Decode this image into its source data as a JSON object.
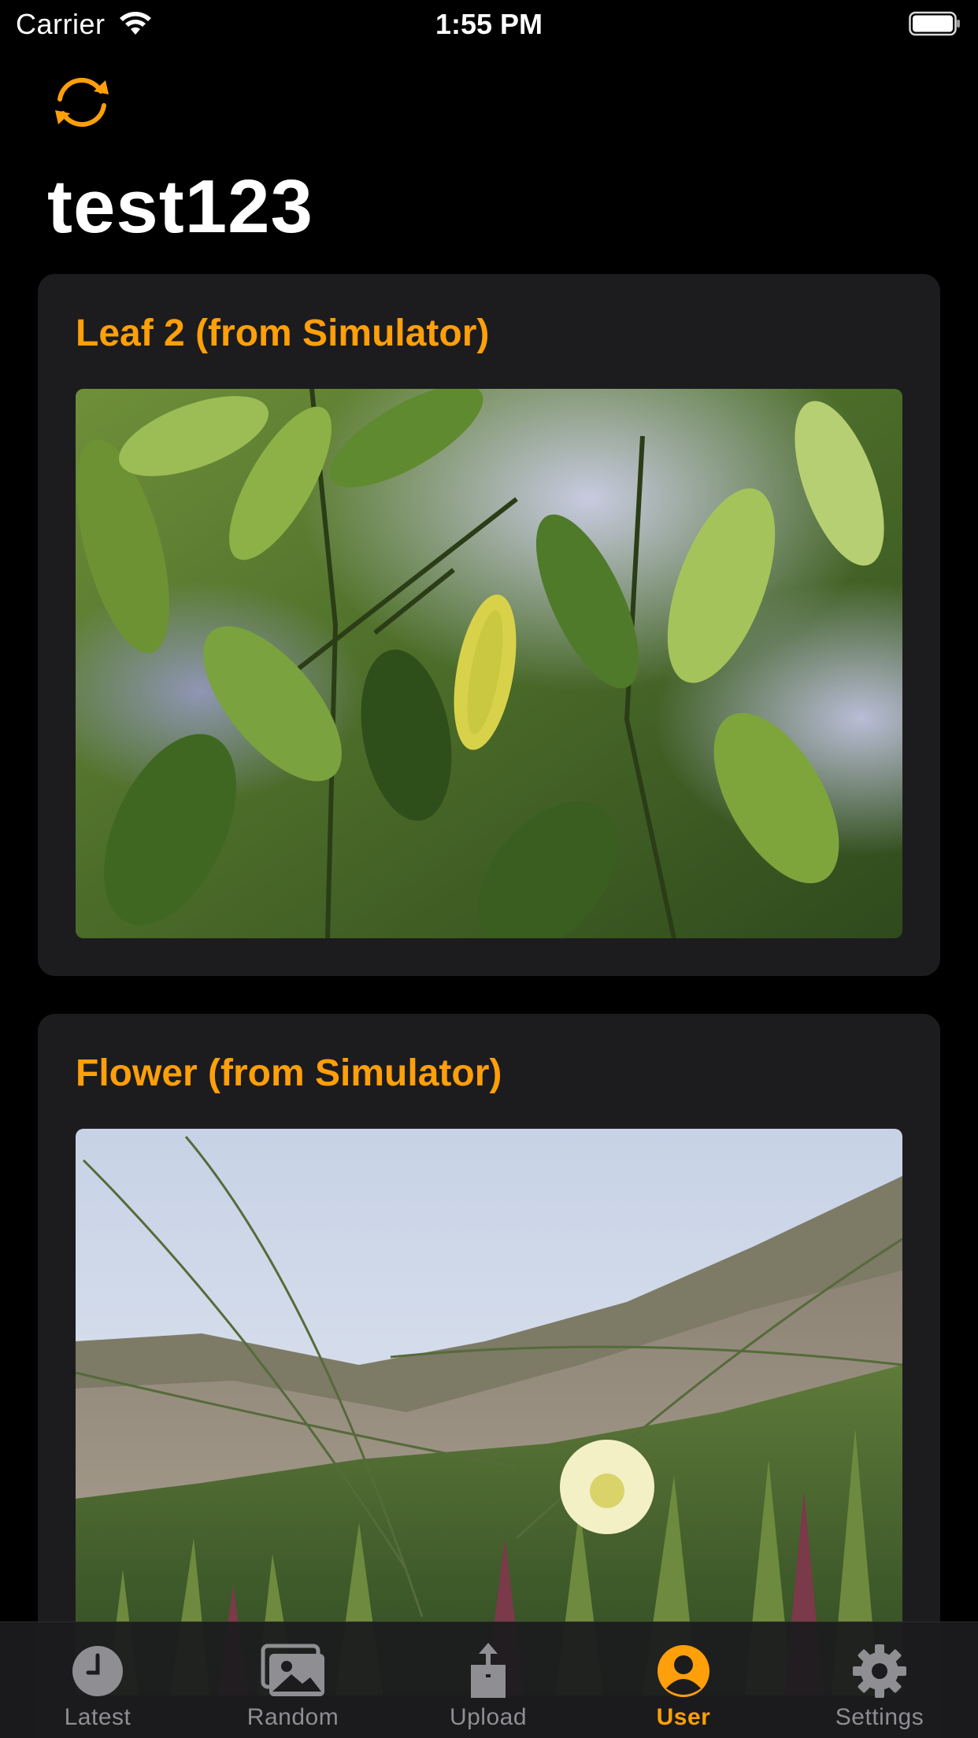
{
  "status_bar": {
    "carrier": "Carrier",
    "time": "1:55 PM"
  },
  "header": {
    "refresh_icon": "arrow-rotate-icon",
    "title": "test123"
  },
  "posts": [
    {
      "title": "Leaf 2 (from Simulator)",
      "photo": "photo of green citrus leaves with one yellow leaf"
    },
    {
      "title": "Flower (from Simulator)",
      "photo": "photo of a pale yellow flower among succulents on a sand dune"
    }
  ],
  "tab_bar": {
    "active": "User",
    "accent_color": "#ff9f0a",
    "inactive_color": "#8e8e93",
    "tabs": [
      {
        "label": "Latest",
        "icon": "clock-icon"
      },
      {
        "label": "Random",
        "icon": "photos-icon"
      },
      {
        "label": "Upload",
        "icon": "share-upload-icon"
      },
      {
        "label": "User",
        "icon": "person-circle-icon"
      },
      {
        "label": "Settings",
        "icon": "gear-icon"
      }
    ]
  },
  "colors": {
    "background": "#000000",
    "card": "#1c1c1e",
    "accent": "#ff9f0a"
  }
}
